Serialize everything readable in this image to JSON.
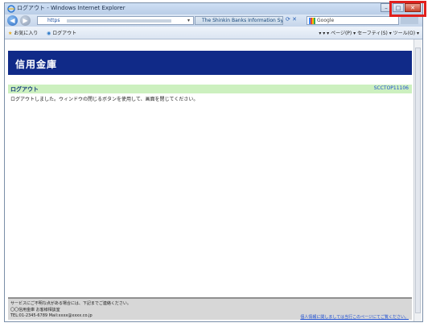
{
  "window": {
    "title": "ログアウト - Windows Internet Explorer",
    "minimize": "–",
    "maximize": "□",
    "close": "✕"
  },
  "addressbar": {
    "back": "◀",
    "forward": "▶",
    "url_prefix": "https",
    "dropdown": "▾",
    "cert_label": "The Shinkin Banks Information Syst...",
    "refresh_stop": "⟳ ✕",
    "search_label": "Google"
  },
  "favorites": {
    "favorites_label": "お気に入り",
    "tab_label": "ログアウト",
    "tools": "▾  ▾  ▾  ページ(P) ▾  セーフティ(S) ▾  ツール(O) ▾"
  },
  "page": {
    "brand": "信用金庫",
    "header_title": "ログアウト",
    "screen_code": "SCCTOP11106",
    "message": "ログアウトしました。ウィンドウの閉じるボタンを使用して、画面を閉じてください。",
    "footer_line1": "サービスにご不明な点がある場合には、下記までご連絡ください。",
    "footer_line2": "〇〇信用金庫 お客様相談室",
    "footer_line3": "TEL:01-2345-6789 Mail:xxxx@xxxx.co.jp",
    "footer_link": "個人情報に関しましては当行このページにてご覧ください。"
  },
  "colors": {
    "brand_bg": "#102a88",
    "header_bg": "#ccf0bf",
    "highlight": "#e0201c"
  }
}
